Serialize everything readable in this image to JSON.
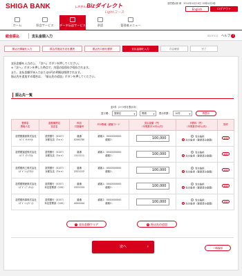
{
  "header": {
    "bank": "SHIGA BANK",
    "service_prefix": "しがぎん",
    "service_name": "Bizダイレクト",
    "service_sub": "Lightコース",
    "user_info": "滋賀銀太郎 様　2024年04月18日 10時00分0秒",
    "lang_label": "English",
    "logout_label": "ログアウト"
  },
  "nav": [
    "ホーム",
    "照会サービス",
    "データ伝送サービス",
    "承認",
    "管理者メニュー"
  ],
  "page": {
    "category": "総合振込",
    "title": "支払金額入力",
    "code": "BSGF013",
    "help": "ヘルプ"
  },
  "steps": [
    "振込元情報を入力",
    "振込先指定方法を選択",
    "振込先口座を選択",
    "支払金額を入力",
    "内容確認",
    "完了"
  ],
  "notes": [
    "支払金額を入力の上、「次へ」ボタンを押してください。",
    "※「次へ」ボタンを押した時点で、内容の仮保存が保存されます。",
    "また、支払金額が未入力または0円の明細は削除されます。",
    "振込先を追加する場合は、「振込先の追加」ボタンを押してください。"
  ],
  "section_title": "振込先一覧",
  "count_text": "全5件（1～5件を表示中）",
  "controls": {
    "sort_label": "並び順：",
    "sort_value": "登録名",
    "order_value": "昇順",
    "perpage_label": "表示件数：",
    "perpage_value": "10件",
    "refresh": "再表示"
  },
  "table": {
    "headers": [
      "登録名\n受取人名",
      "金融機関名\n支店名",
      "科目\n口座番号",
      "EDI情報／顧客コード",
      "支払金額（円）\n（半角数字10桁以内）",
      "手数料（円）\n（半角数字5桁以内）",
      "操作"
    ],
    "rows": [
      {
        "name": "滋賀銀建設株式会社",
        "kana": "ｼｶﾞｷﾞﾝｹﾝｾﾂ(ｶ",
        "bank": "滋賀銀行（0157）",
        "branch": "京都支店（3××）",
        "type": "普通",
        "acct": "0246780",
        "edi": "顧客1：0000000000",
        "edi2": "顧客2：",
        "amount": "100,000",
        "fee1": "当方負担",
        "fee2": "先方負担（登録済み金額）",
        "sel": 2,
        "op": "削除"
      },
      {
        "name": "滋賀銀運送株式会社",
        "kana": "ｼｶﾞｷﾞﾝｳﾝｿｳ(ｶ",
        "bank": "滋賀銀行（0157）",
        "branch": "京都支店（3××）",
        "type": "普通",
        "acct": "1111111",
        "edi": "顧客1：0000000000",
        "edi2": "顧客2：",
        "amount": "100,000",
        "fee1": "当方負担",
        "fee2": "先方負担（登録済み金額）",
        "sel": 2,
        "op": "削除"
      },
      {
        "name": "滋賀銀商工株式会社",
        "kana": "ｼｶﾞｷﾞﾝｼｮｳｺｳ(ｶ",
        "bank": "滋賀銀行（0157）",
        "branch": "京都支店（3××）",
        "type": "普通",
        "acct": "2222222",
        "edi": "顧客1：0000000000",
        "edi2": "顧客2：",
        "amount": "100,000",
        "fee1": "当方負担",
        "fee2": "先方負担（登録済み金額）",
        "sel": 2,
        "op": "削除"
      },
      {
        "name": "滋賀銀物産株式会社",
        "kana": "ｼｶﾞｷﾞﾝﾌﾞｯｻﾝ(ｶ",
        "bank": "滋賀銀行（0157）",
        "branch": "本店営業部（100）",
        "type": "普通",
        "acct": "3333333",
        "edi": "顧客1：0000000000",
        "edi2": "顧客2：",
        "amount": "100,000",
        "fee1": "当方負担",
        "fee2": "先方負担（登録済み金額）",
        "sel": 2,
        "op": "削除"
      },
      {
        "name": "滋賀銀商事株式会社",
        "kana": "ｼｶﾞｷﾞﾝｼｮｳｼﾞ(ｶ",
        "bank": "滋賀銀行（0157）",
        "branch": "本店営業部（100）",
        "type": "普通",
        "acct": "4444444",
        "edi": "顧客1：0000000000",
        "edi2": "顧客2：",
        "amount": "100,000",
        "fee1": "当方負担",
        "fee2": "先方負担（登録済み金額）",
        "sel": 2,
        "op": "削除"
      }
    ]
  },
  "buttons": {
    "clear": "支払金額クリア",
    "add": "振込先の追加",
    "next": "次へ",
    "save": "一時保存"
  },
  "colors": {
    "brand": "#d6001c",
    "header_bg": "#fbe9ea"
  }
}
